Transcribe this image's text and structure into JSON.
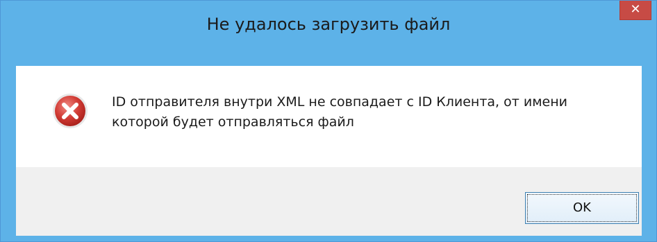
{
  "window": {
    "title": "Не удалось загрузить файл",
    "close_icon": "close-icon",
    "accent_color": "#5db2e8",
    "close_color": "#c74b45"
  },
  "dialog": {
    "icon": "error-icon",
    "message_line1": "ID отправителя внутри XML не совпадает с ID Клиента, от имени",
    "message_line2": "которой будет отправляться файл"
  },
  "buttons": {
    "ok_label": "OK"
  }
}
